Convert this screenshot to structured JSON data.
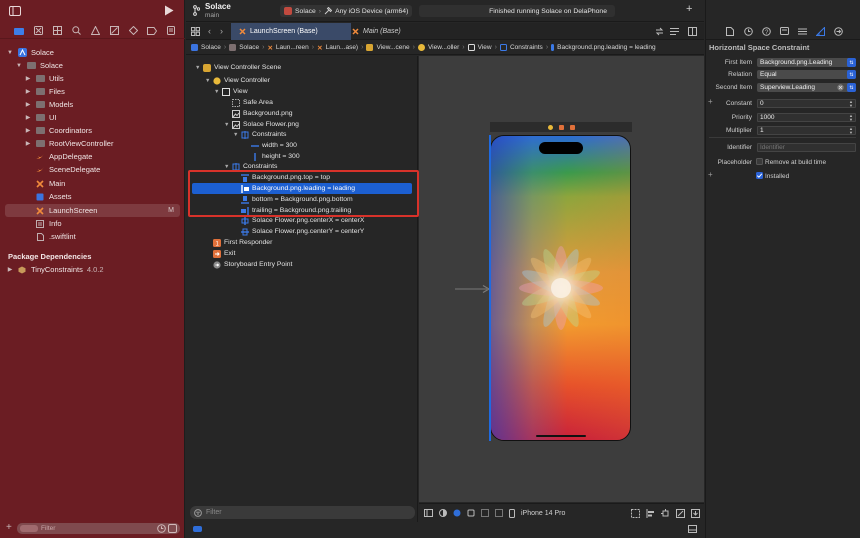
{
  "toolbar": {
    "project_name": "Solace",
    "branch": "main",
    "scheme": "Solace",
    "destination": "Any iOS Device (arm64)",
    "status": "Finished running Solace on DelaPhone"
  },
  "tabs": [
    {
      "label": "LaunchScreen (Base)",
      "active": true
    },
    {
      "label": "Main (Base)",
      "active": false
    }
  ],
  "jump_bar": [
    "Solace",
    "Solace",
    "Laun...reen",
    "Laun...ase)",
    "View...cene",
    "View...oller",
    "View",
    "Constraints",
    "Background.png.leading = leading"
  ],
  "navigator": {
    "items": [
      {
        "label": "Solace",
        "kind": "project",
        "level": 0,
        "expanded": true
      },
      {
        "label": "Solace",
        "kind": "folder",
        "level": 1,
        "expanded": true
      },
      {
        "label": "Utils",
        "kind": "folder",
        "level": 2
      },
      {
        "label": "Files",
        "kind": "folder",
        "level": 2
      },
      {
        "label": "Models",
        "kind": "folder",
        "level": 2
      },
      {
        "label": "UI",
        "kind": "folder",
        "level": 2
      },
      {
        "label": "Coordinators",
        "kind": "folder",
        "level": 2
      },
      {
        "label": "RootViewController",
        "kind": "folder",
        "level": 2
      },
      {
        "label": "AppDelegate",
        "kind": "swift",
        "level": 2
      },
      {
        "label": "SceneDelegate",
        "kind": "swift",
        "level": 2
      },
      {
        "label": "Main",
        "kind": "storyboard",
        "level": 2
      },
      {
        "label": "Assets",
        "kind": "assets",
        "level": 2
      },
      {
        "label": "LaunchScreen",
        "kind": "storyboard",
        "level": 2,
        "selected": true,
        "badge": "M"
      },
      {
        "label": "Info",
        "kind": "plist",
        "level": 2
      },
      {
        "label": ".swiftlint",
        "kind": "file",
        "level": 2
      }
    ],
    "package_header": "Package Dependencies",
    "package": {
      "name": "TinyConstraints",
      "version": "4.0.2"
    },
    "filter_placeholder": "Filter"
  },
  "outline": {
    "rows": [
      {
        "label": "View Controller Scene",
        "level": 0,
        "icon": "scene-icon",
        "disc": "down"
      },
      {
        "label": "View Controller",
        "level": 1,
        "icon": "view-controller-icon",
        "disc": "down"
      },
      {
        "label": "View",
        "level": 2,
        "icon": "view-icon",
        "disc": "down"
      },
      {
        "label": "Safe Area",
        "level": 3,
        "icon": "safe-area-icon"
      },
      {
        "label": "Background.png",
        "level": 3,
        "icon": "image-view-icon"
      },
      {
        "label": "Solace Flower.png",
        "level": 3,
        "icon": "image-view-icon",
        "disc": "down"
      },
      {
        "label": "Constraints",
        "level": 4,
        "icon": "constraints-icon",
        "disc": "down"
      },
      {
        "label": "width = 300",
        "level": 5,
        "icon": "width-constraint-icon"
      },
      {
        "label": "height = 300",
        "level": 5,
        "icon": "height-constraint-icon"
      },
      {
        "label": "Constraints",
        "level": 3,
        "icon": "constraints-icon",
        "disc": "down"
      },
      {
        "label": "Background.png.top = top",
        "level": 4,
        "icon": "top-constraint-icon"
      },
      {
        "label": "Background.png.leading = leading",
        "level": 4,
        "icon": "leading-constraint-icon",
        "selected": true
      },
      {
        "label": "bottom = Background.png.bottom",
        "level": 4,
        "icon": "bottom-constraint-icon"
      },
      {
        "label": "trailing = Background.png.trailing",
        "level": 4,
        "icon": "trailing-constraint-icon"
      },
      {
        "label": "Solace Flower.png.centerX = centerX",
        "level": 4,
        "icon": "centerx-constraint-icon"
      },
      {
        "label": "Solace Flower.png.centerY = centerY",
        "level": 4,
        "icon": "centery-constraint-icon"
      },
      {
        "label": "First Responder",
        "level": 1,
        "icon": "first-responder-icon"
      },
      {
        "label": "Exit",
        "level": 1,
        "icon": "exit-icon"
      },
      {
        "label": "Storyboard Entry Point",
        "level": 1,
        "icon": "entry-point-icon"
      }
    ],
    "filter_placeholder": "Filter"
  },
  "canvas": {
    "device": "iPhone 14 Pro"
  },
  "inspector": {
    "title": "Horizontal Space Constraint",
    "first_item_label": "First Item",
    "first_item": "Background.png.Leading",
    "relation_label": "Relation",
    "relation": "Equal",
    "second_item_label": "Second Item",
    "second_item": "Superview.Leading",
    "constant_label": "Constant",
    "constant": "0",
    "priority_label": "Priority",
    "priority": "1000",
    "multiplier_label": "Multiplier",
    "multiplier": "1",
    "identifier_label": "Identifier",
    "identifier_placeholder": "Identifier",
    "placeholder_label": "Placeholder",
    "remove_at_build_time": "Remove at build time",
    "installed": "Installed"
  },
  "colors": {
    "navigator_bg": "#6b1d23",
    "selection_blue": "#1c5fd1",
    "highlight_red": "#d8322a",
    "swift_orange": "#f08a3c"
  }
}
